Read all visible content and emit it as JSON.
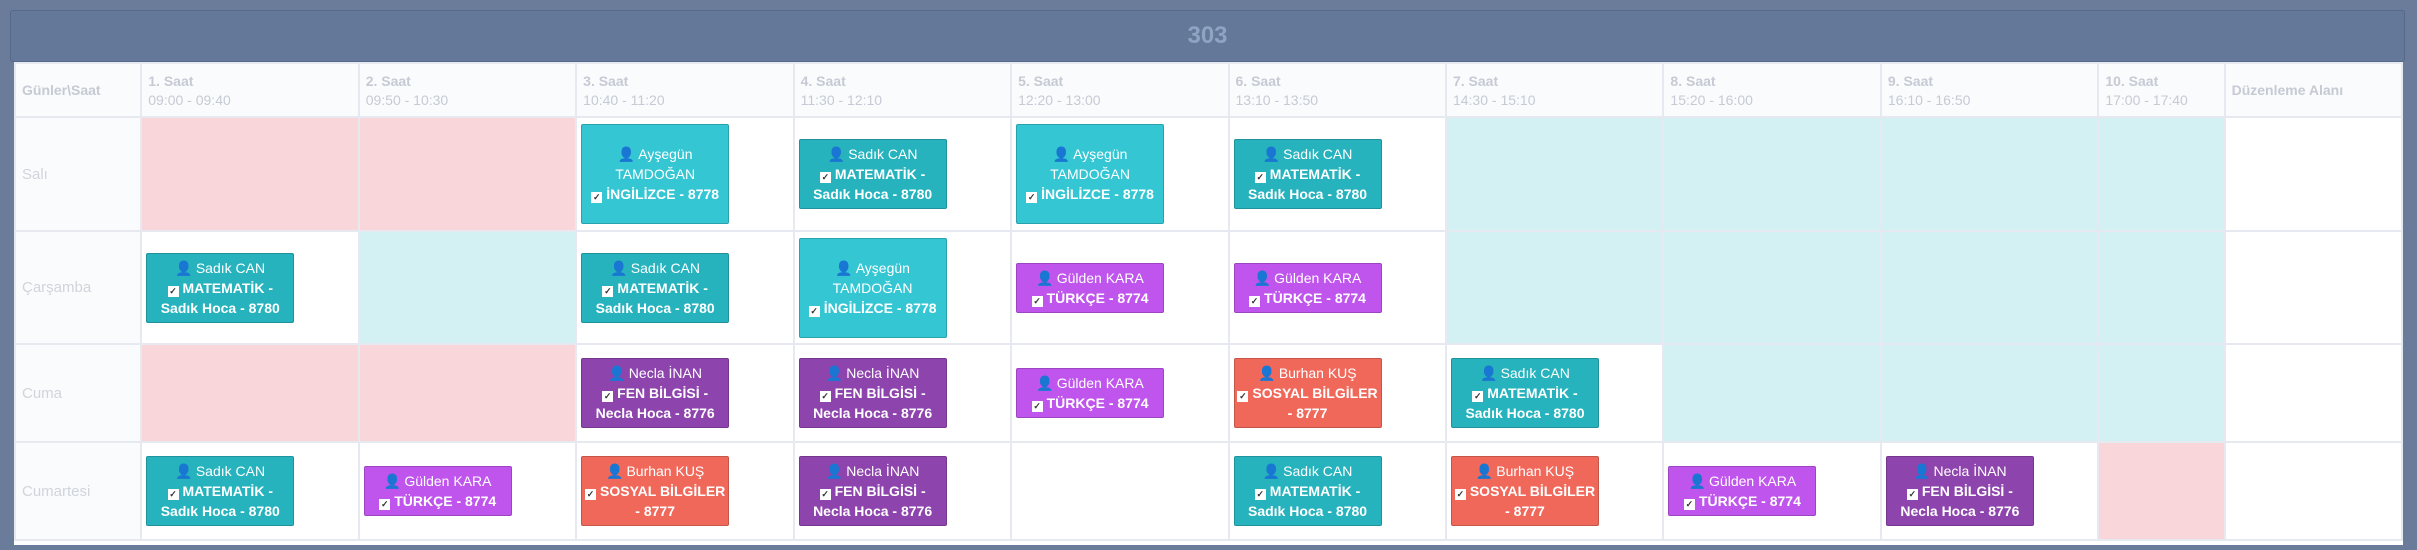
{
  "title": "303",
  "corner_label": "Günler\\Saat",
  "edit_area_label": "Düzenleme Alanı",
  "periods": [
    {
      "name": "1. Saat",
      "time": "09:00 - 09:40"
    },
    {
      "name": "2. Saat",
      "time": "09:50 - 10:30"
    },
    {
      "name": "3. Saat",
      "time": "10:40 - 11:20"
    },
    {
      "name": "4. Saat",
      "time": "11:30 - 12:10"
    },
    {
      "name": "5. Saat",
      "time": "12:20 - 13:00"
    },
    {
      "name": "6. Saat",
      "time": "13:10 - 13:50"
    },
    {
      "name": "7. Saat",
      "time": "14:30 - 15:10"
    },
    {
      "name": "8. Saat",
      "time": "15:20 - 16:00"
    },
    {
      "name": "9. Saat",
      "time": "16:10 - 16:50"
    },
    {
      "name": "10. Saat",
      "time": "17:00 - 17:40"
    }
  ],
  "days": [
    "Salı",
    "Çarşamba",
    "Cuma",
    "Cumartesi"
  ],
  "lessons": {
    "sadik": {
      "teacher": "Sadık CAN",
      "course": "MATEMATİK - Sadık Hoca - 8780"
    },
    "aysegul": {
      "teacher": "Ayşegün TAMDOĞAN",
      "course": "İNGİLİZCE - 8778"
    },
    "gulden": {
      "teacher": "Gülden KARA",
      "course": "TÜRKÇE - 8774"
    },
    "necla": {
      "teacher": "Necla İNAN",
      "course": "FEN BİLGİSİ - Necla Hoca - 8776"
    },
    "burhan": {
      "teacher": "Burhan KUŞ",
      "course": "SOSYAL BİLGİLER - 8777"
    }
  },
  "colors": {
    "unavailable": "#f9d6da",
    "available": "#d3f1f3",
    "matematik": "#26b3bd",
    "ingilizce": "#34c6d3",
    "fen": "#8e44ad",
    "turkce": "#bf55ec",
    "sosyal": "#f0685a"
  }
}
